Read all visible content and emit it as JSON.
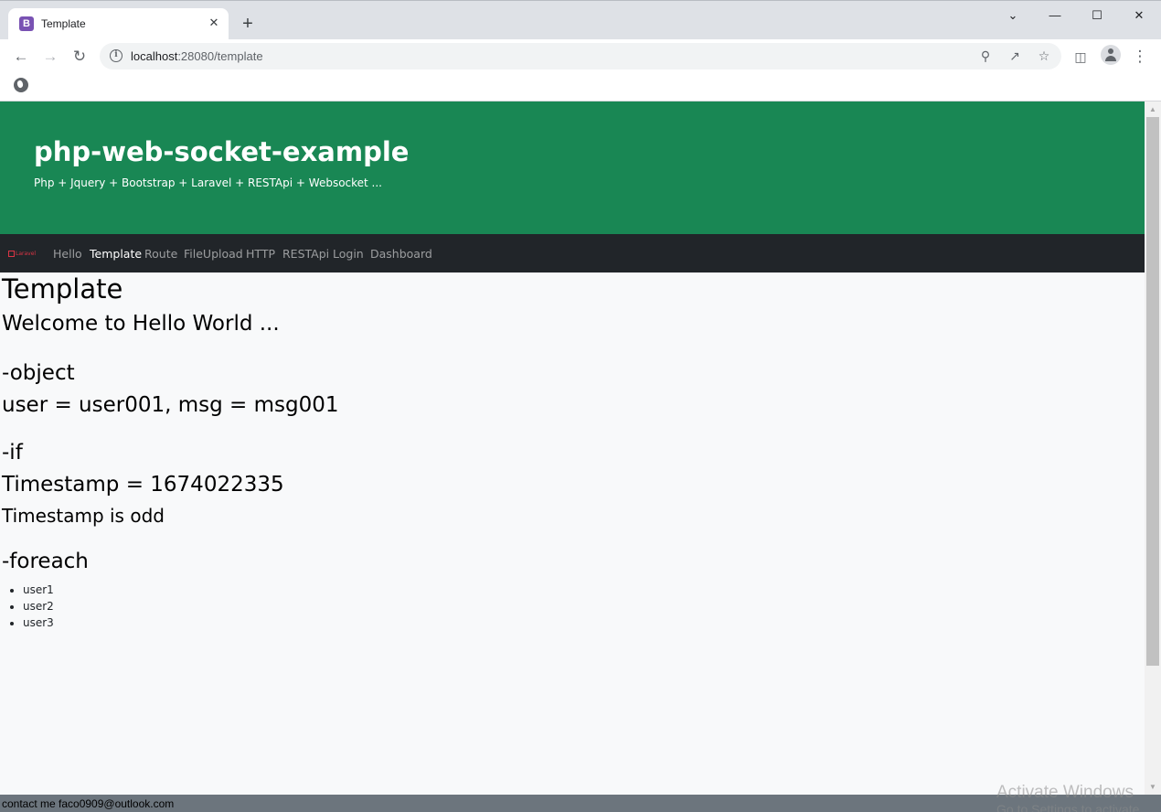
{
  "browser": {
    "tab_title": "Template",
    "tab_favicon_letter": "B",
    "new_tab_symbol": "+",
    "close_symbol": "✕",
    "url_host": "localhost",
    "url_path": ":28080/template",
    "window_controls": {
      "minimize": "—",
      "maximize": "☐",
      "close": "✕",
      "tab_search": "⌄"
    }
  },
  "hero": {
    "title": "php-web-socket-example",
    "subtitle": "Php + Jquery + Bootstrap + Laravel + RESTApi + Websocket ..."
  },
  "navbar": {
    "brand": "Laravel",
    "items": [
      {
        "label": "Hello",
        "active": false
      },
      {
        "label": "Template",
        "active": true
      },
      {
        "label": "Route",
        "active": false
      },
      {
        "label": "FileUpload",
        "active": false
      },
      {
        "label": "HTTP",
        "active": false
      },
      {
        "label": "RESTApi",
        "active": false
      },
      {
        "label": "Login",
        "active": false
      },
      {
        "label": "Dashboard",
        "active": false
      }
    ]
  },
  "content": {
    "page_heading": "Template",
    "welcome": "Welcome to Hello World ...",
    "object_heading": "-object",
    "object_line": "user = user001, msg = msg001",
    "if_heading": "-if",
    "timestamp_line": "Timestamp = 1674022335",
    "timestamp_parity": "Timestamp is odd",
    "foreach_heading": "-foreach",
    "users": [
      "user1",
      "user2",
      "user3"
    ]
  },
  "footer": {
    "contact": "contact me faco0909@outlook.com"
  },
  "os_watermark": {
    "line1": "Activate Windows",
    "line2": "Go to Settings to activate"
  },
  "colors": {
    "hero_bg": "#198754",
    "navbar_bg": "#212529",
    "page_bg": "#f8f9fa",
    "status_bg": "#6c757d"
  }
}
